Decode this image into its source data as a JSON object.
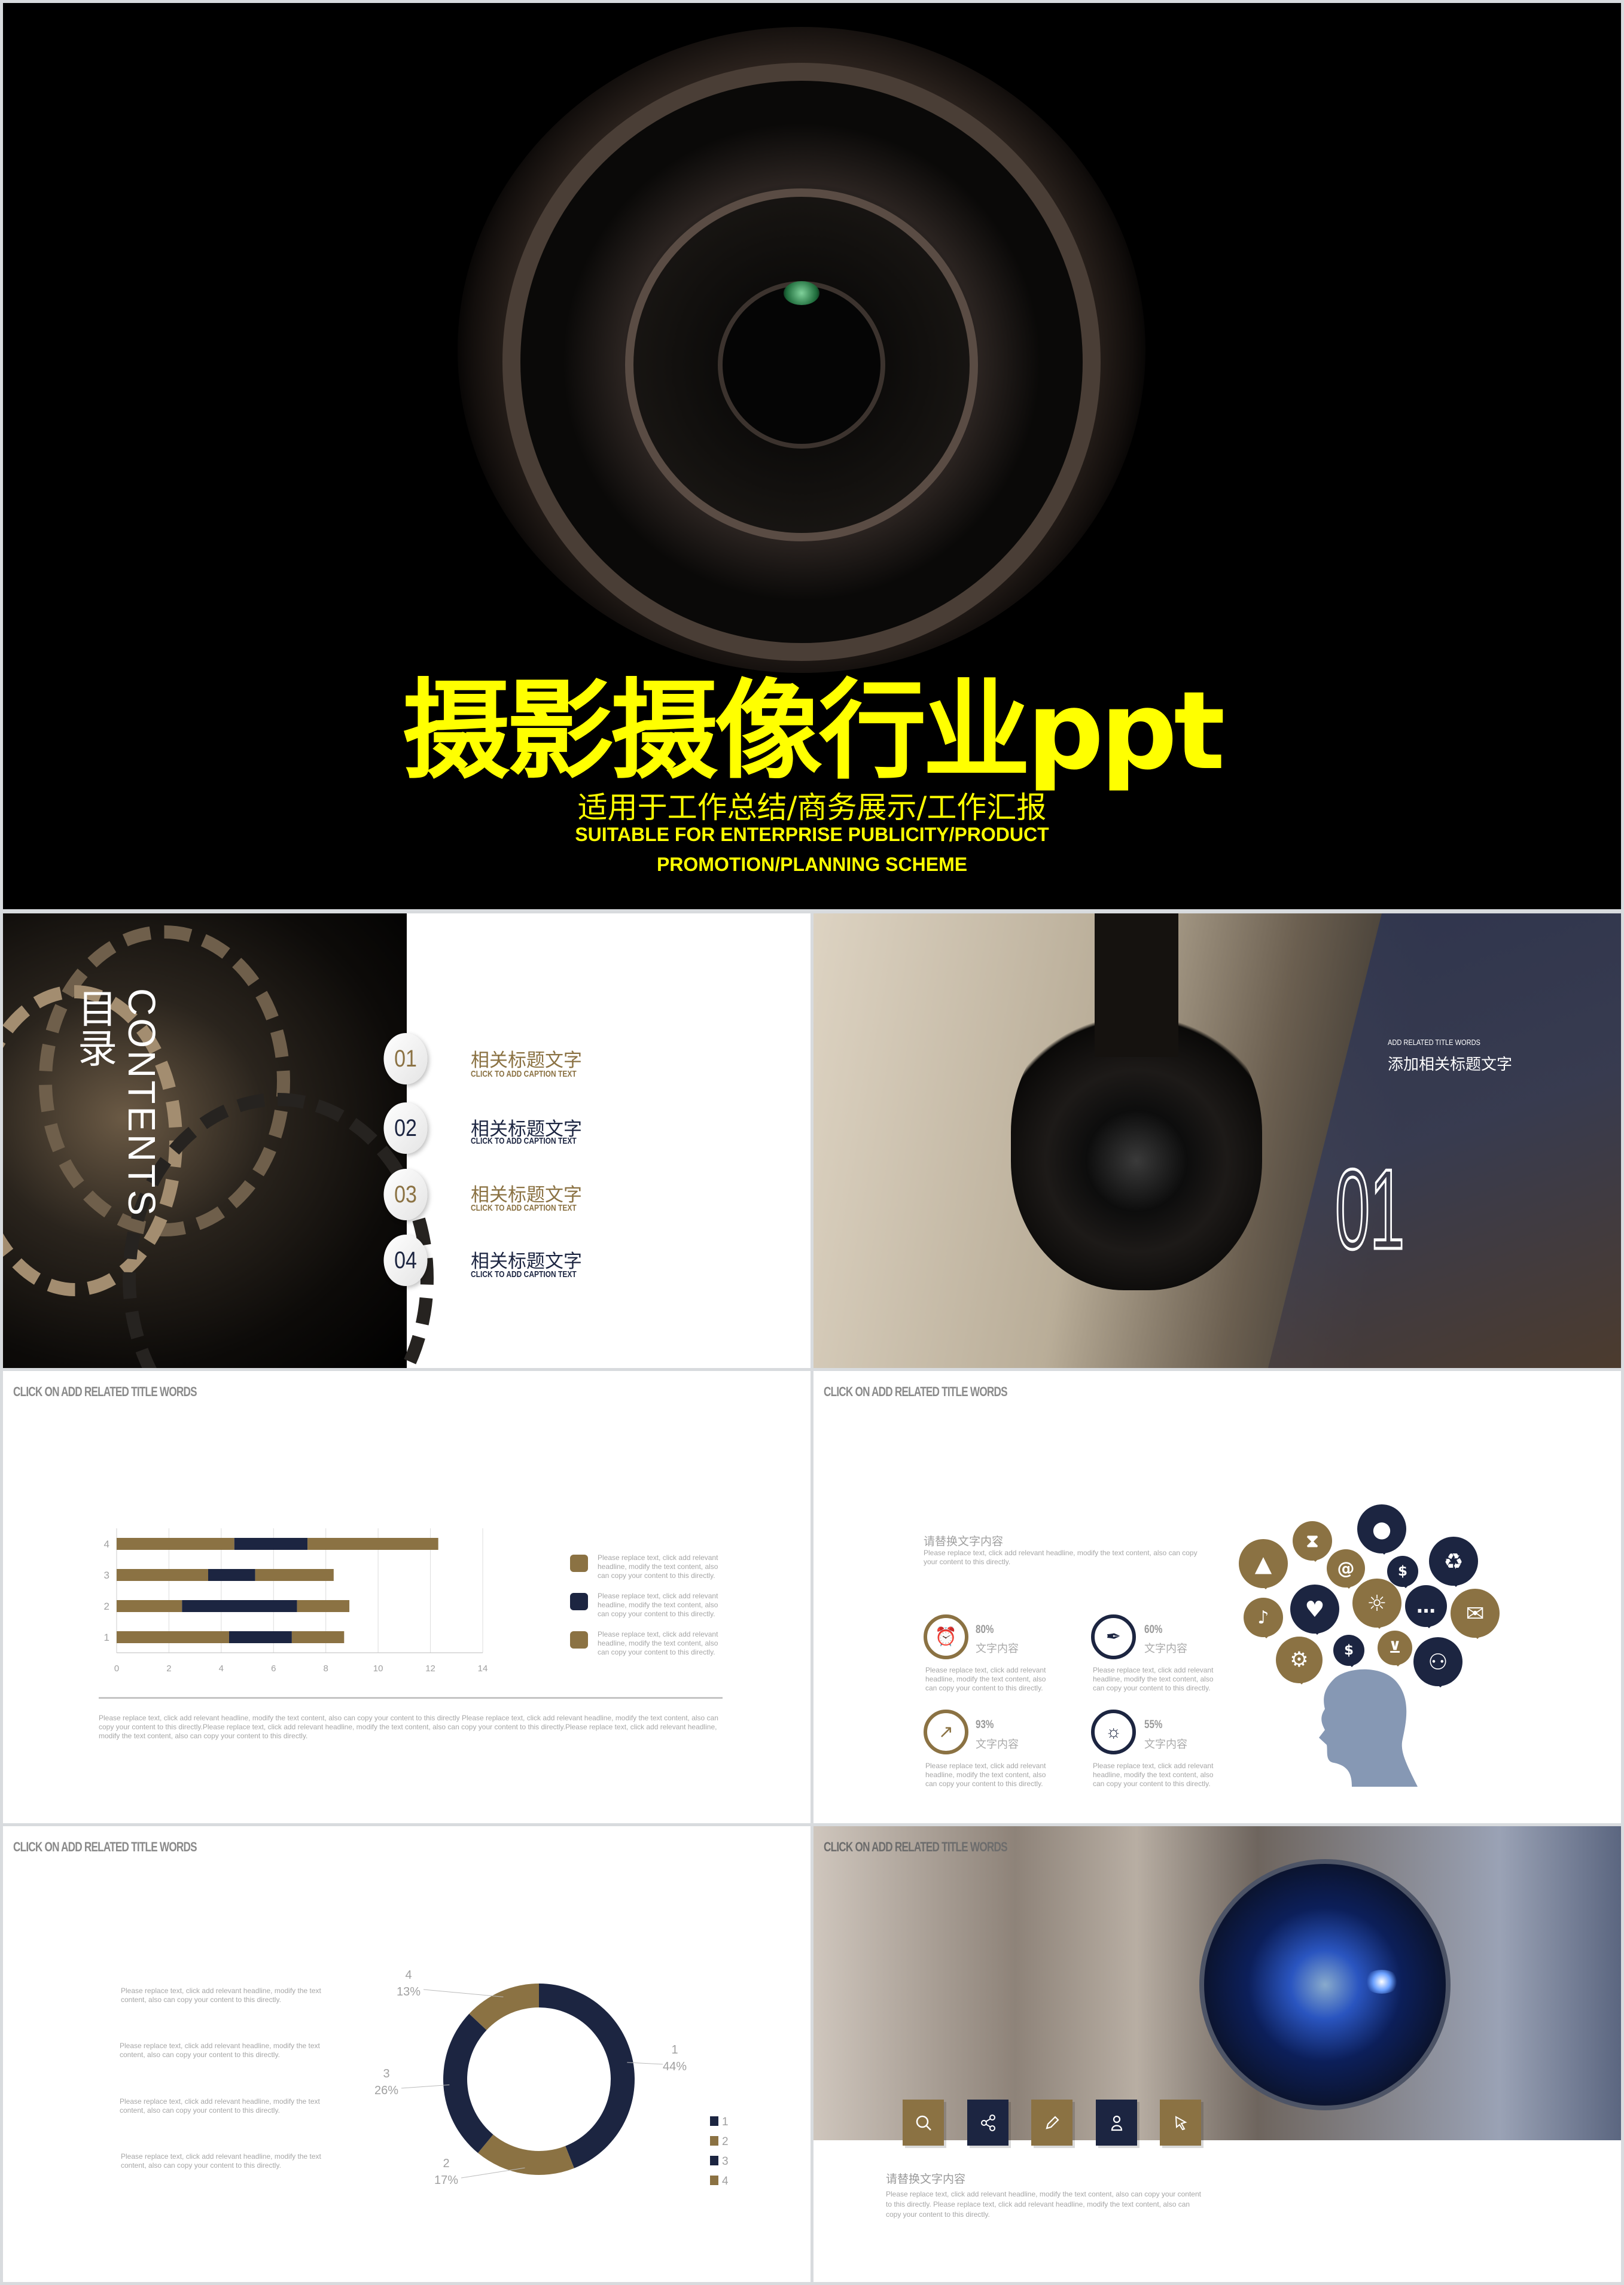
{
  "colors": {
    "gold": "#8b7243",
    "navy": "#1c2541",
    "title_yellow": "#ffff00",
    "head_silhouette": "#8698b4"
  },
  "title_slide": {
    "title": "摄影摄像行业ppt",
    "subtitle_cn": "适用于工作总结/商务展示/工作汇报",
    "subtitle_en_1": "SUITABLE FOR ENTERPRISE PUBLICITY/PRODUCT",
    "subtitle_en_2": "PROMOTION/PLANNING SCHEME"
  },
  "contents_slide": {
    "heading_cn": "目录",
    "heading_en": "CONTENTS",
    "items": [
      {
        "num": "01",
        "title": "相关标题文字",
        "caption": "CLICK TO ADD CAPTION TEXT",
        "color": "gold"
      },
      {
        "num": "02",
        "title": "相关标题文字",
        "caption": "CLICK TO ADD CAPTION TEXT",
        "color": "navy"
      },
      {
        "num": "03",
        "title": "相关标题文字",
        "caption": "CLICK TO ADD CAPTION TEXT",
        "color": "gold"
      },
      {
        "num": "04",
        "title": "相关标题文字",
        "caption": "CLICK TO ADD CAPTION TEXT",
        "color": "navy"
      }
    ]
  },
  "section_slide": {
    "small": "ADD RELATED TITLE WORDS",
    "title": "添加相关标题文字",
    "number": "01"
  },
  "bar_slide": {
    "title": "CLICK ON ADD RELATED TITLE WORDS",
    "legend": [
      "Please replace text, click add relevant headline, modify the text content, also can copy your content to this directly.",
      "Please replace text, click add relevant headline, modify the text content, also can copy your content to this directly.",
      "Please replace text, click add relevant headline, modify the text content, also can copy your content to this directly."
    ],
    "paragraph": "Please replace text, click add relevant headline, modify the text content, also can copy your content to this directly Please replace text, click add relevant headline, modify the text content, also can copy your content to this directly.Please replace text, click add relevant headline, modify the text content, also can copy your content to this directly.Please replace text, click add relevant headline, modify the text content, also can copy your content to this directly."
  },
  "info_slide": {
    "title": "CLICK ON ADD RELATED TITLE WORDS",
    "heading": "请替换文字内容",
    "intro": "Please replace text, click add relevant headline, modify the text content, also can copy your content to this directly.",
    "stats": [
      {
        "value": "80%",
        "label": "文字内容",
        "text": "Please replace text, click add relevant headline, modify the text content, also can copy your content to this directly.",
        "icon": "alarm-clock",
        "color": "gold"
      },
      {
        "value": "60%",
        "label": "文字内容",
        "text": "Please replace text, click add relevant headline, modify the text content, also can copy your content to this directly.",
        "icon": "pen-nib",
        "color": "navy"
      },
      {
        "value": "93%",
        "label": "文字内容",
        "text": "Please replace text, click add relevant headline, modify the text content, also can copy your content to this directly.",
        "icon": "growth-chart",
        "color": "gold"
      },
      {
        "value": "55%",
        "label": "文字内容",
        "text": "Please replace text, click add relevant headline, modify the text content, also can copy your content to this directly.",
        "icon": "lightbulb",
        "color": "navy"
      }
    ],
    "bubbles": [
      "graduation-cap",
      "hourglass",
      "piggy-bank",
      "at-sign",
      "dollar",
      "recycle",
      "music",
      "heart",
      "lightbulb",
      "chat",
      "mail",
      "gears",
      "dollar",
      "cart",
      "people"
    ]
  },
  "donut_slide": {
    "title": "CLICK ON ADD RELATED TITLE WORDS",
    "paragraphs": [
      "Please replace text, click add relevant headline, modify the text content, also can copy your content to this directly.",
      "Please replace text, click add relevant headline, modify the text content, also can copy your content to this directly.",
      "Please replace text, click add relevant headline, modify the text content, also can copy your content to this directly.",
      "Please replace text, click add relevant headline, modify the text content, also can copy your content to this directly."
    ]
  },
  "photo_slide": {
    "title": "CLICK ON ADD RELATED TITLE WORDS",
    "heading": "请替换文字内容",
    "paragraph": "Please replace text, click add relevant headline, modify the text content, also can copy your content to this directly. Please replace text, click add relevant headline, modify the text content, also can copy your content to this directly.",
    "buttons": [
      {
        "icon": "search",
        "color": "gold"
      },
      {
        "icon": "share",
        "color": "navy"
      },
      {
        "icon": "pencil",
        "color": "gold"
      },
      {
        "icon": "user",
        "color": "navy"
      },
      {
        "icon": "cursor",
        "color": "gold"
      }
    ]
  },
  "chart_data": [
    {
      "type": "bar",
      "orientation": "horizontal",
      "stacked": true,
      "categories": [
        "1",
        "2",
        "3",
        "4"
      ],
      "series": [
        {
          "color": "#8b7243",
          "values": [
            4.3,
            2.5,
            3.5,
            4.5
          ]
        },
        {
          "color": "#1c2541",
          "values": [
            2.4,
            4.4,
            1.8,
            2.8
          ]
        },
        {
          "color": "#8b7243",
          "values": [
            2.0,
            2.0,
            3.0,
            5.0
          ]
        }
      ],
      "xlim": [
        0,
        14
      ],
      "xticks": [
        "0",
        "2",
        "4",
        "6",
        "8",
        "10",
        "12",
        "14"
      ],
      "grid": true
    },
    {
      "type": "pie",
      "donut": true,
      "categories": [
        "1",
        "2",
        "3",
        "4"
      ],
      "values": [
        44,
        17,
        26,
        13
      ],
      "labels": [
        "44%",
        "17%",
        "26%",
        "13%"
      ],
      "colors": [
        "#1c2541",
        "#8b7243",
        "#1c2541",
        "#8b7243"
      ],
      "legend": "right"
    }
  ]
}
